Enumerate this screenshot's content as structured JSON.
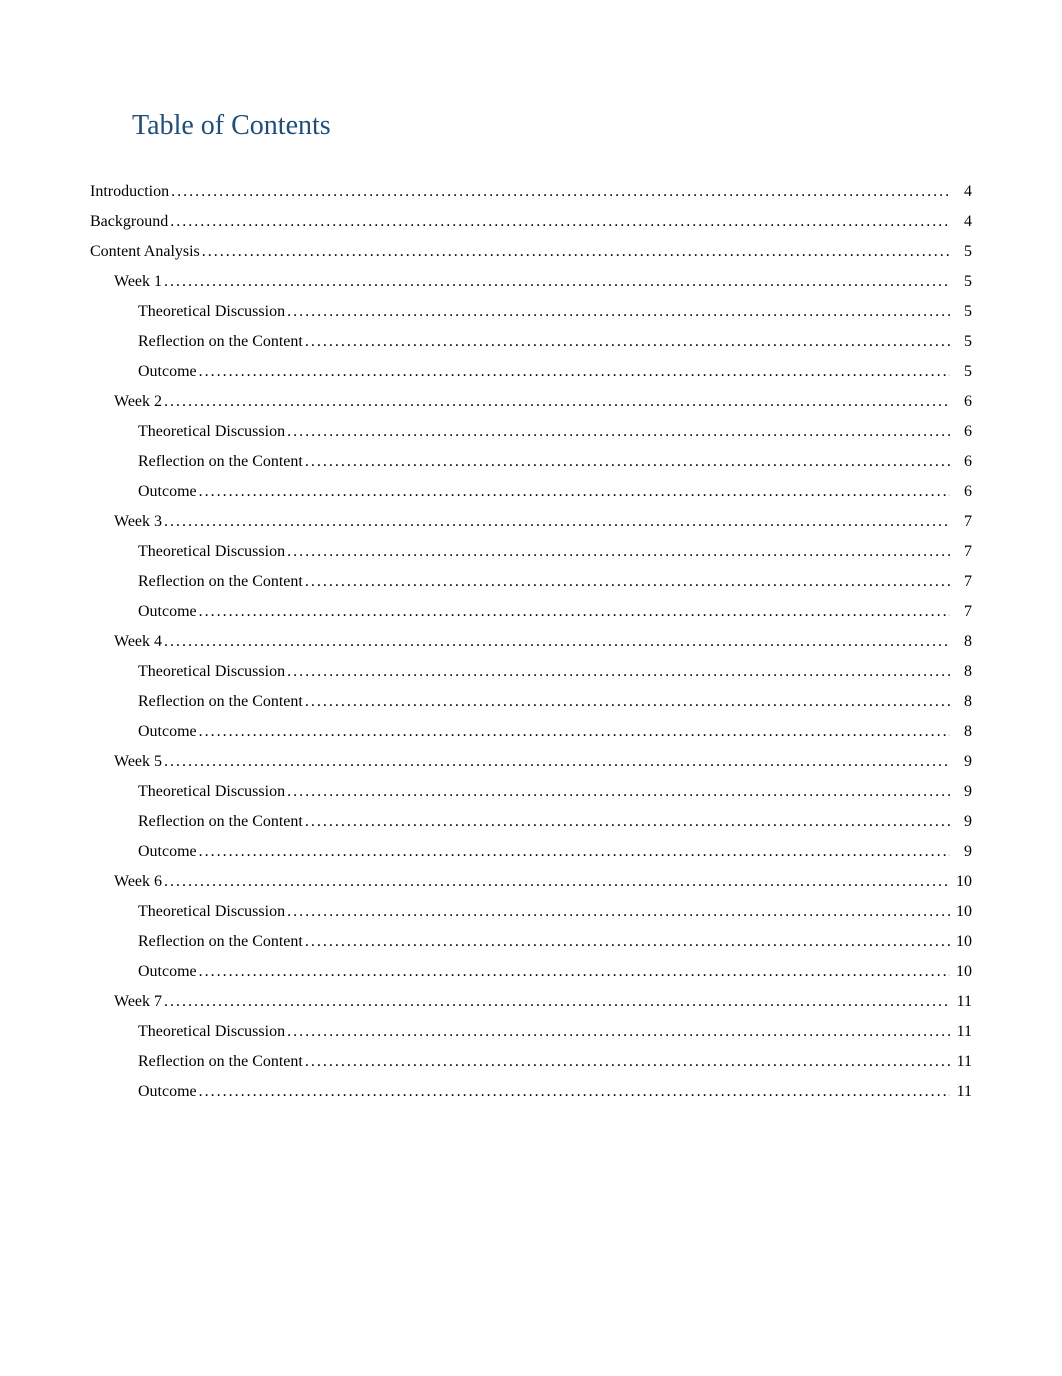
{
  "title": "Table of Contents",
  "toc": [
    {
      "label": "Introduction",
      "page": "4",
      "level": 0
    },
    {
      "label": "Background",
      "page": "4",
      "level": 0
    },
    {
      "label": "Content Analysis",
      "page": "5",
      "level": 0
    },
    {
      "label": "Week 1",
      "page": "5",
      "level": 1
    },
    {
      "label": "Theoretical Discussion",
      "page": "5",
      "level": 2
    },
    {
      "label": "Reflection on the Content",
      "page": "5",
      "level": 2
    },
    {
      "label": "Outcome",
      "page": "5",
      "level": 2
    },
    {
      "label": "Week 2",
      "page": "6",
      "level": 1
    },
    {
      "label": "Theoretical Discussion",
      "page": "6",
      "level": 2
    },
    {
      "label": "Reflection on the Content",
      "page": "6",
      "level": 2
    },
    {
      "label": "Outcome",
      "page": "6",
      "level": 2
    },
    {
      "label": "Week 3",
      "page": "7",
      "level": 1
    },
    {
      "label": "Theoretical Discussion",
      "page": "7",
      "level": 2
    },
    {
      "label": "Reflection on the Content",
      "page": "7",
      "level": 2
    },
    {
      "label": "Outcome",
      "page": "7",
      "level": 2
    },
    {
      "label": "Week 4",
      "page": "8",
      "level": 1
    },
    {
      "label": "Theoretical Discussion",
      "page": "8",
      "level": 2
    },
    {
      "label": "Reflection on the Content",
      "page": "8",
      "level": 2
    },
    {
      "label": "Outcome",
      "page": "8",
      "level": 2
    },
    {
      "label": "Week 5",
      "page": "9",
      "level": 1
    },
    {
      "label": "Theoretical Discussion",
      "page": "9",
      "level": 2
    },
    {
      "label": "Reflection on the Content",
      "page": "9",
      "level": 2
    },
    {
      "label": "Outcome",
      "page": "9",
      "level": 2
    },
    {
      "label": "Week 6",
      "page": "10",
      "level": 1
    },
    {
      "label": "Theoretical Discussion",
      "page": "10",
      "level": 2
    },
    {
      "label": "Reflection on the Content",
      "page": "10",
      "level": 2
    },
    {
      "label": "Outcome",
      "page": "10",
      "level": 2
    },
    {
      "label": "Week 7",
      "page": "11",
      "level": 1
    },
    {
      "label": "Theoretical Discussion",
      "page": "11",
      "level": 2
    },
    {
      "label": "Reflection on the Content",
      "page": "11",
      "level": 2
    },
    {
      "label": "Outcome",
      "page": "11",
      "level": 2
    }
  ]
}
